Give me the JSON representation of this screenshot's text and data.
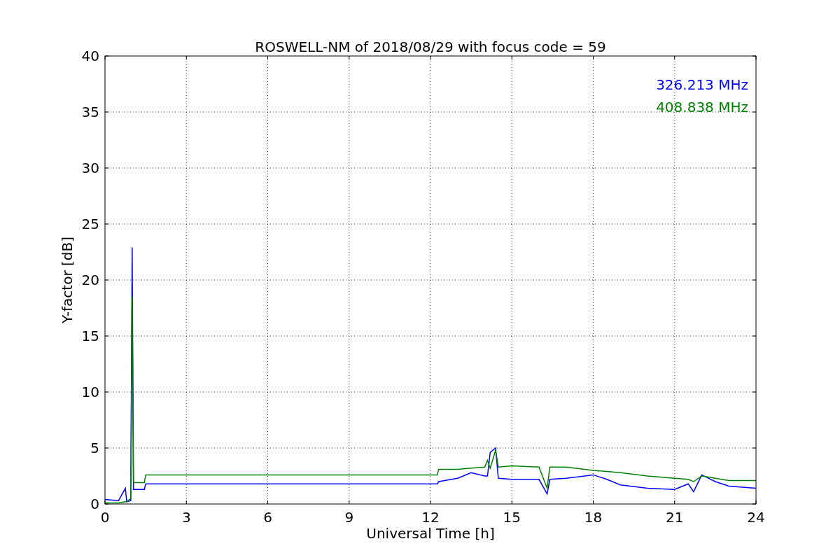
{
  "chart_data": {
    "type": "line",
    "title": "ROSWELL-NM of 2018/08/29 with focus code = 59",
    "xlabel": "Universal Time [h]",
    "ylabel": "Y-factor [dB]",
    "grid": true,
    "xlim": [
      0,
      24
    ],
    "ylim": [
      0,
      40
    ],
    "xticks": [
      0,
      3,
      6,
      9,
      12,
      15,
      18,
      21,
      24
    ],
    "yticks": [
      0,
      5,
      10,
      15,
      20,
      25,
      30,
      35,
      40
    ],
    "x": [
      0,
      0.5,
      0.75,
      0.8,
      0.95,
      1.0,
      1.05,
      1.45,
      1.5,
      12.25,
      12.3,
      13,
      13.5,
      14,
      14.1,
      14.2,
      14.4,
      14.5,
      15,
      16,
      16.3,
      16.4,
      17,
      18,
      18.5,
      19,
      20,
      21,
      21.5,
      21.7,
      22,
      22.5,
      23,
      24
    ],
    "series": [
      {
        "name": "326.213 MHz",
        "color": "#0000ff",
        "values": [
          0.4,
          0.3,
          1.4,
          0.2,
          0.3,
          22.9,
          1.3,
          1.3,
          1.8,
          1.8,
          2.0,
          2.3,
          2.8,
          2.5,
          2.5,
          4.6,
          5.0,
          2.3,
          2.2,
          2.2,
          0.9,
          2.2,
          2.3,
          2.6,
          2.2,
          1.7,
          1.4,
          1.3,
          1.8,
          1.1,
          2.6,
          2.0,
          1.6,
          1.4
        ]
      },
      {
        "name": "408.838 MHz",
        "color": "#008000",
        "values": [
          0.1,
          0.1,
          0.2,
          0.2,
          0.5,
          18.5,
          1.9,
          1.9,
          2.6,
          2.6,
          3.1,
          3.1,
          3.2,
          3.3,
          3.9,
          3.2,
          4.8,
          3.3,
          3.4,
          3.3,
          1.4,
          3.3,
          3.3,
          3.0,
          2.9,
          2.8,
          2.5,
          2.3,
          2.2,
          2.0,
          2.5,
          2.3,
          2.1,
          2.1
        ]
      }
    ]
  }
}
